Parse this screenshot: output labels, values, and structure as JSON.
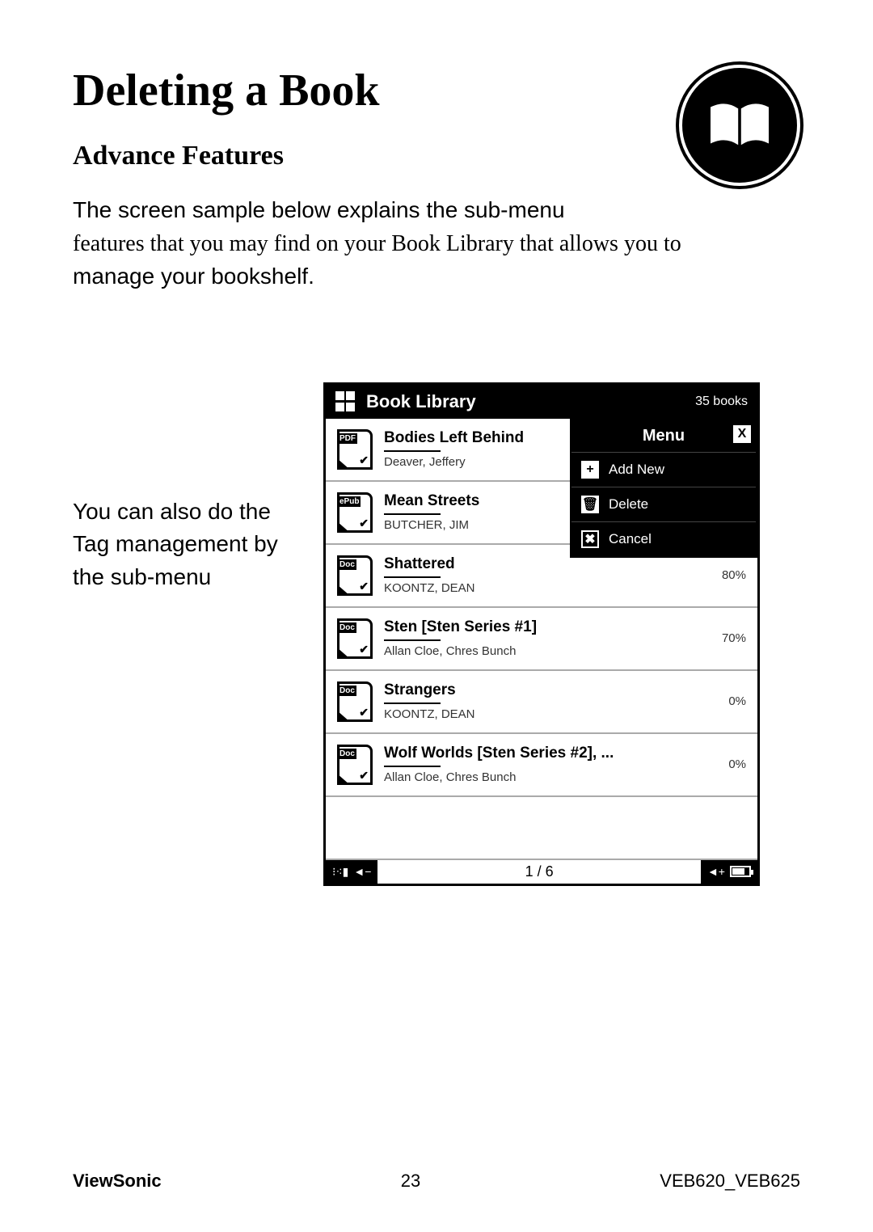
{
  "page": {
    "title": "Deleting a Book",
    "subtitle": "Advance Features",
    "intro_line1": "The screen sample below explains the sub-menu",
    "intro_line2": "features that you may find on your Book Library that allows you to",
    "intro_line3": "manage your bookshelf.",
    "side_note": "You can also do the Tag management by the sub-menu"
  },
  "device": {
    "header_title": "Book Library",
    "book_count": "35 books",
    "pager": "1 / 6",
    "menu": {
      "title": "Menu",
      "close": "X",
      "items": [
        {
          "icon": "+",
          "label": "Add New"
        },
        {
          "icon": "🗑",
          "label": "Delete"
        },
        {
          "icon": "✖",
          "label": "Cancel"
        }
      ]
    },
    "books": [
      {
        "format": "PDF",
        "title": "Bodies Left Behind",
        "author": "Deaver, Jeffery",
        "progress": ""
      },
      {
        "format": "ePub",
        "title": "Mean Streets",
        "author": "BUTCHER, JIM",
        "progress": ""
      },
      {
        "format": "Doc",
        "title": "Shattered",
        "author": "KOONTZ, DEAN",
        "progress": "80%"
      },
      {
        "format": "Doc",
        "title": "Sten [Sten Series #1]",
        "author": "Allan Cloe, Chres Bunch",
        "progress": "70%"
      },
      {
        "format": "Doc",
        "title": "Strangers",
        "author": "KOONTZ, DEAN",
        "progress": "0%"
      },
      {
        "format": "Doc",
        "title": "Wolf Worlds [Sten Series #2], ...",
        "author": "Allan Cloe, Chres Bunch",
        "progress": "0%"
      }
    ]
  },
  "footer": {
    "brand": "ViewSonic",
    "page_number": "23",
    "model": "VEB620_VEB625"
  }
}
